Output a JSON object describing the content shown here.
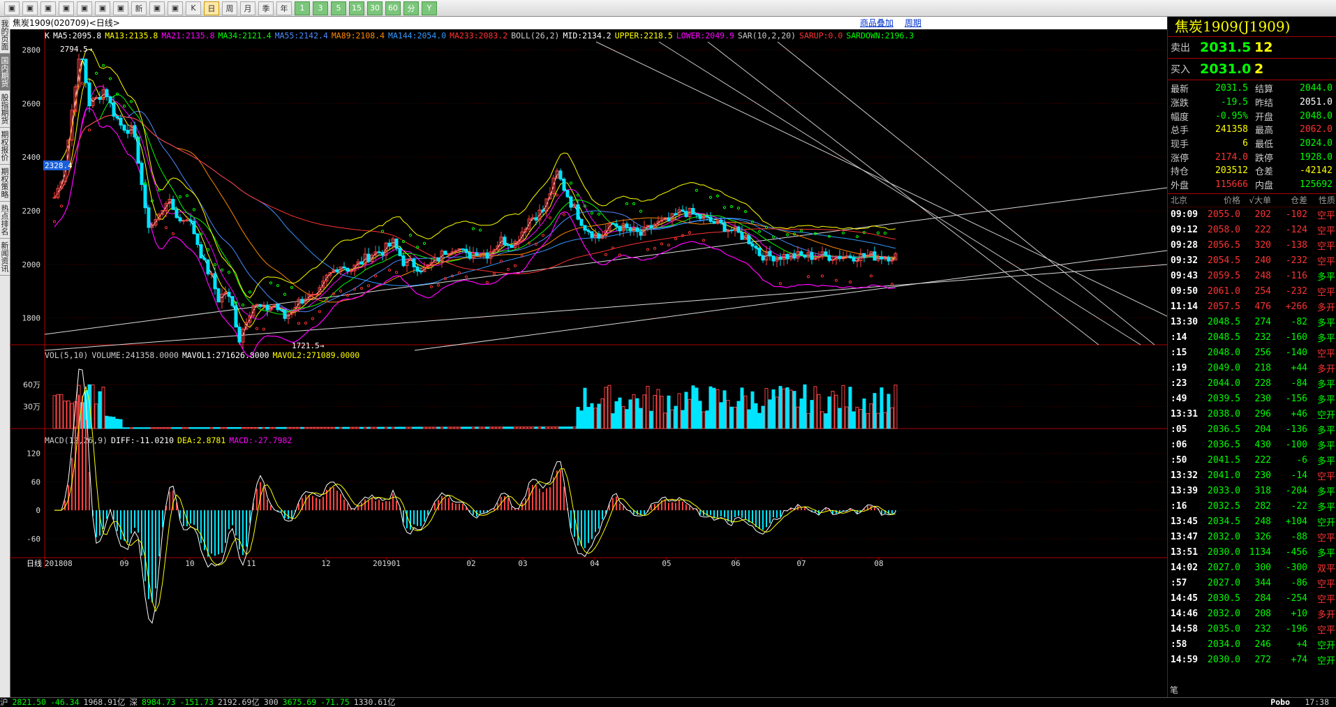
{
  "toolbar": {
    "buttons": [
      "home",
      "folder",
      "search",
      "zoom",
      "window",
      "pen",
      "filter",
      "新",
      "table",
      "line",
      "K",
      "日",
      "周",
      "月",
      "季",
      "年",
      "1",
      "3",
      "5",
      "15",
      "30",
      "60",
      "分",
      "Y"
    ]
  },
  "sidebar": {
    "tabs": [
      "我的页面",
      "国内期货",
      "股指期货",
      "期权报价",
      "期权策略",
      "热点排名",
      "新闻资讯"
    ]
  },
  "title": {
    "instrument": "焦炭1909(020709)<日线>",
    "link1": "商品叠加",
    "link2": "周期"
  },
  "legends": {
    "kline": [
      {
        "t": "K",
        "c": "#ffffff"
      },
      {
        "t": "MA5:2095.8",
        "c": "#ffffff"
      },
      {
        "t": "MA13:2135.8",
        "c": "#ffff00"
      },
      {
        "t": "MA21:2135.8",
        "c": "#ff00ff"
      },
      {
        "t": "MA34:2121.4",
        "c": "#00ff00"
      },
      {
        "t": "MA55:2142.4",
        "c": "#4a8cff"
      },
      {
        "t": "MA89:2108.4",
        "c": "#ff8800"
      },
      {
        "t": "MA144:2054.0",
        "c": "#3399ff"
      },
      {
        "t": "MA233:2083.2",
        "c": "#ff3333"
      },
      {
        "t": "BOLL(26,2)",
        "c": "#cccccc"
      },
      {
        "t": "MID:2134.2",
        "c": "#ffffff"
      },
      {
        "t": "UPPER:2218.5",
        "c": "#ffff00"
      },
      {
        "t": "LOWER:2049.9",
        "c": "#ff00ff"
      },
      {
        "t": "SAR(10,2,20)",
        "c": "#cccccc"
      },
      {
        "t": "SARUP:0.0",
        "c": "#ff3333"
      },
      {
        "t": "SARDOWN:2196.3",
        "c": "#00ff00"
      }
    ],
    "vol": [
      {
        "t": "VOL(5,10)",
        "c": "#cccccc"
      },
      {
        "t": "VOLUME:241358.0000",
        "c": "#cccccc"
      },
      {
        "t": "MAVOL1:271626.8000",
        "c": "#ffffff"
      },
      {
        "t": "MAVOL2:271089.0000",
        "c": "#ffff00"
      }
    ],
    "macd": [
      {
        "t": "MACD(12,26,9)",
        "c": "#cccccc"
      },
      {
        "t": "DIFF:-11.0210",
        "c": "#ffffff"
      },
      {
        "t": "DEA:2.8781",
        "c": "#ffff00"
      },
      {
        "t": "MACD:-27.7982",
        "c": "#ff00ff"
      }
    ]
  },
  "annotations": {
    "high": "2794.5",
    "low": "1721.5",
    "cursor_price": "2328.4"
  },
  "period_label": "日线",
  "chart_data": {
    "type": "candlestick",
    "title": "焦炭1909(020709)<日线>",
    "y_ticks_price": [
      2800,
      2600,
      2400,
      2200,
      2000,
      1800
    ],
    "ylim_price": [
      1700,
      2830
    ],
    "y_ticks_vol": [
      "60万",
      "30万"
    ],
    "ylim_vol": [
      0,
      950000
    ],
    "y_ticks_macd": [
      120,
      60,
      0,
      -60
    ],
    "ylim_macd": [
      -100,
      140
    ],
    "x_ticks": [
      "201808",
      "09",
      "10",
      "11",
      "12",
      "201901",
      "02",
      "03",
      "04",
      "05",
      "06",
      "07",
      "08"
    ],
    "price_path_x": [
      0,
      8,
      15,
      22,
      28,
      38,
      50,
      62,
      72,
      82,
      95,
      110,
      118,
      125,
      132,
      140,
      150,
      160,
      172,
      180,
      190,
      200,
      215,
      225,
      235,
      245,
      255,
      265,
      275,
      285,
      300,
      315,
      330,
      345,
      360,
      375,
      390,
      408,
      425,
      440,
      455,
      470,
      485,
      500,
      515,
      530,
      545,
      560,
      575,
      590,
      605,
      620,
      640,
      660,
      680,
      700,
      720,
      740,
      760,
      780,
      800,
      820,
      840,
      860,
      880,
      900,
      920,
      940,
      960,
      975,
      990,
      1000,
      1010,
      1020,
      1030,
      1045,
      1060,
      1080,
      1100,
      1120,
      1140,
      1160,
      1180,
      1195,
      1206
    ],
    "price_path": [
      2250,
      2300,
      2380,
      2500,
      2650,
      2794,
      2600,
      2620,
      2660,
      2580,
      2520,
      2500,
      2430,
      2300,
      2150,
      2150,
      2180,
      2240,
      2200,
      2160,
      2180,
      2120,
      2000,
      1950,
      1870,
      1900,
      1840,
      1721,
      1800,
      1850,
      1830,
      1850,
      1800,
      1850,
      1880,
      1870,
      1950,
      2000,
      1980,
      2010,
      2040,
      2050,
      2080,
      2010,
      2000,
      1980,
      2010,
      2050,
      2070,
      2030,
      2050,
      2040,
      2090,
      2080,
      2170,
      2200,
      2340,
      2230,
      2140,
      2100,
      2150,
      2130,
      2110,
      2150,
      2160,
      2200,
      2180,
      2160,
      2140,
      2120,
      2100,
      2080,
      2040,
      2030,
      2031,
      2031,
      2031,
      2031,
      2031,
      2031,
      2031,
      2031,
      2031,
      2031,
      2031
    ],
    "volume_note": "volume bars rise from near zero (Aug-Mar) to ~400k-650k (Apr-Aug)",
    "macd_note": "MACD histogram red/cyan bars around zero axis; DIFF white, DEA yellow"
  },
  "quote": {
    "title": "焦炭1909(J1909)",
    "sell_label": "卖出",
    "sell_price": "2031.5",
    "sell_vol": "12",
    "buy_label": "买入",
    "buy_price": "2031.0",
    "buy_vol": "2",
    "stats": [
      {
        "k1": "最新",
        "v1": "2031.5",
        "c1": "#0f0",
        "k2": "结算",
        "v2": "2044.0",
        "c2": "#0f0"
      },
      {
        "k1": "涨跌",
        "v1": "-19.5",
        "c1": "#0f0",
        "k2": "昨结",
        "v2": "2051.0",
        "c2": "#fff"
      },
      {
        "k1": "幅度",
        "v1": "-0.95%",
        "c1": "#0f0",
        "k2": "开盘",
        "v2": "2048.0",
        "c2": "#0f0"
      },
      {
        "k1": "总手",
        "v1": "241358",
        "c1": "#ff0",
        "k2": "最高",
        "v2": "2062.0",
        "c2": "#f33"
      },
      {
        "k1": "现手",
        "v1": "6",
        "c1": "#ff0",
        "k2": "最低",
        "v2": "2024.0",
        "c2": "#0f0"
      },
      {
        "k1": "涨停",
        "v1": "2174.0",
        "c1": "#f33",
        "k2": "跌停",
        "v2": "1928.0",
        "c2": "#0f0"
      },
      {
        "k1": "持仓",
        "v1": "203512",
        "c1": "#ff0",
        "k2": "仓差",
        "v2": "-42142",
        "c2": "#ff0"
      },
      {
        "k1": "外盘",
        "v1": "115666",
        "c1": "#f33",
        "k2": "内盘",
        "v2": "125692",
        "c2": "#0f0"
      }
    ],
    "tick_header": [
      "北京",
      "价格",
      "√大单",
      "仓差",
      "性质"
    ],
    "ticks": [
      {
        "t": "09:09",
        "p": "2055.0",
        "v": "202",
        "d": "-102",
        "n": "空平",
        "pc": "#f33",
        "nc": "#f33"
      },
      {
        "t": "09:12",
        "p": "2058.0",
        "v": "222",
        "d": "-124",
        "n": "空平",
        "pc": "#f33",
        "nc": "#f33"
      },
      {
        "t": "09:28",
        "p": "2056.5",
        "v": "320",
        "d": "-138",
        "n": "空平",
        "pc": "#f33",
        "nc": "#f33"
      },
      {
        "t": "09:32",
        "p": "2054.5",
        "v": "240",
        "d": "-232",
        "n": "空平",
        "pc": "#f33",
        "nc": "#f33"
      },
      {
        "t": "09:43",
        "p": "2059.5",
        "v": "248",
        "d": "-116",
        "n": "多平",
        "pc": "#f33",
        "nc": "#0f0"
      },
      {
        "t": "09:50",
        "p": "2061.0",
        "v": "254",
        "d": "-232",
        "n": "空平",
        "pc": "#f33",
        "nc": "#f33"
      },
      {
        "t": "11:14",
        "p": "2057.5",
        "v": "476",
        "d": "+266",
        "n": "多开",
        "pc": "#f33",
        "nc": "#f33"
      },
      {
        "t": "13:30",
        "p": "2048.5",
        "v": "274",
        "d": "-82",
        "n": "多平",
        "pc": "#0f0",
        "nc": "#0f0"
      },
      {
        "t": ":14",
        "p": "2048.5",
        "v": "232",
        "d": "-160",
        "n": "多平",
        "pc": "#0f0",
        "nc": "#0f0"
      },
      {
        "t": ":15",
        "p": "2048.0",
        "v": "256",
        "d": "-140",
        "n": "空平",
        "pc": "#0f0",
        "nc": "#f33"
      },
      {
        "t": ":19",
        "p": "2049.0",
        "v": "218",
        "d": "+44",
        "n": "多开",
        "pc": "#0f0",
        "nc": "#f33"
      },
      {
        "t": ":23",
        "p": "2044.0",
        "v": "228",
        "d": "-84",
        "n": "多平",
        "pc": "#0f0",
        "nc": "#0f0"
      },
      {
        "t": ":49",
        "p": "2039.5",
        "v": "230",
        "d": "-156",
        "n": "多平",
        "pc": "#0f0",
        "nc": "#0f0"
      },
      {
        "t": "13:31",
        "p": "2038.0",
        "v": "296",
        "d": "+46",
        "n": "空开",
        "pc": "#0f0",
        "nc": "#0f0"
      },
      {
        "t": ":05",
        "p": "2036.5",
        "v": "204",
        "d": "-136",
        "n": "多平",
        "pc": "#0f0",
        "nc": "#0f0"
      },
      {
        "t": ":06",
        "p": "2036.5",
        "v": "430",
        "d": "-100",
        "n": "多平",
        "pc": "#0f0",
        "nc": "#0f0"
      },
      {
        "t": ":50",
        "p": "2041.5",
        "v": "222",
        "d": "-6",
        "n": "多平",
        "pc": "#0f0",
        "nc": "#0f0"
      },
      {
        "t": "13:32",
        "p": "2041.0",
        "v": "230",
        "d": "-14",
        "n": "空平",
        "pc": "#0f0",
        "nc": "#f33"
      },
      {
        "t": "13:39",
        "p": "2033.0",
        "v": "318",
        "d": "-204",
        "n": "多平",
        "pc": "#0f0",
        "nc": "#0f0"
      },
      {
        "t": ":16",
        "p": "2032.5",
        "v": "282",
        "d": "-22",
        "n": "多平",
        "pc": "#0f0",
        "nc": "#0f0"
      },
      {
        "t": "13:45",
        "p": "2034.5",
        "v": "248",
        "d": "+104",
        "n": "空开",
        "pc": "#0f0",
        "nc": "#0f0"
      },
      {
        "t": "13:47",
        "p": "2032.0",
        "v": "326",
        "d": "-88",
        "n": "空平",
        "pc": "#0f0",
        "nc": "#f33"
      },
      {
        "t": "13:51",
        "p": "2030.0",
        "v": "1134",
        "d": "-456",
        "n": "多平",
        "pc": "#0f0",
        "nc": "#0f0"
      },
      {
        "t": "14:02",
        "p": "2027.0",
        "v": "300",
        "d": "-300",
        "n": "双平",
        "pc": "#0f0",
        "nc": "#f33"
      },
      {
        "t": ":57",
        "p": "2027.0",
        "v": "344",
        "d": "-86",
        "n": "空平",
        "pc": "#0f0",
        "nc": "#f33"
      },
      {
        "t": "14:45",
        "p": "2030.5",
        "v": "284",
        "d": "-254",
        "n": "空平",
        "pc": "#0f0",
        "nc": "#f33"
      },
      {
        "t": "14:46",
        "p": "2032.0",
        "v": "208",
        "d": "+10",
        "n": "多开",
        "pc": "#0f0",
        "nc": "#f33"
      },
      {
        "t": "14:58",
        "p": "2035.0",
        "v": "232",
        "d": "-196",
        "n": "空平",
        "pc": "#0f0",
        "nc": "#f33"
      },
      {
        "t": ":58",
        "p": "2034.0",
        "v": "246",
        "d": "+4",
        "n": "空开",
        "pc": "#0f0",
        "nc": "#0f0"
      },
      {
        "t": "14:59",
        "p": "2030.0",
        "v": "272",
        "d": "+74",
        "n": "空开",
        "pc": "#0f0",
        "nc": "#0f0"
      }
    ],
    "footer_tab": "笔"
  },
  "status": [
    {
      "t": "沪",
      "c": "#ccc"
    },
    {
      "t": "2821.50",
      "c": "#0f0"
    },
    {
      "t": "-46.34",
      "c": "#0f0"
    },
    {
      "t": "1968.91亿",
      "c": "#ccc"
    },
    {
      "t": "深",
      "c": "#ccc"
    },
    {
      "t": "8984.73",
      "c": "#0f0"
    },
    {
      "t": "-151.73",
      "c": "#0f0"
    },
    {
      "t": "2192.69亿",
      "c": "#ccc"
    },
    {
      "t": "300",
      "c": "#ccc"
    },
    {
      "t": "3675.69",
      "c": "#0f0"
    },
    {
      "t": "-71.75",
      "c": "#0f0"
    },
    {
      "t": "1330.61亿",
      "c": "#ccc"
    }
  ],
  "status_right": {
    "brand": "Pobo",
    "time": "17:38"
  }
}
